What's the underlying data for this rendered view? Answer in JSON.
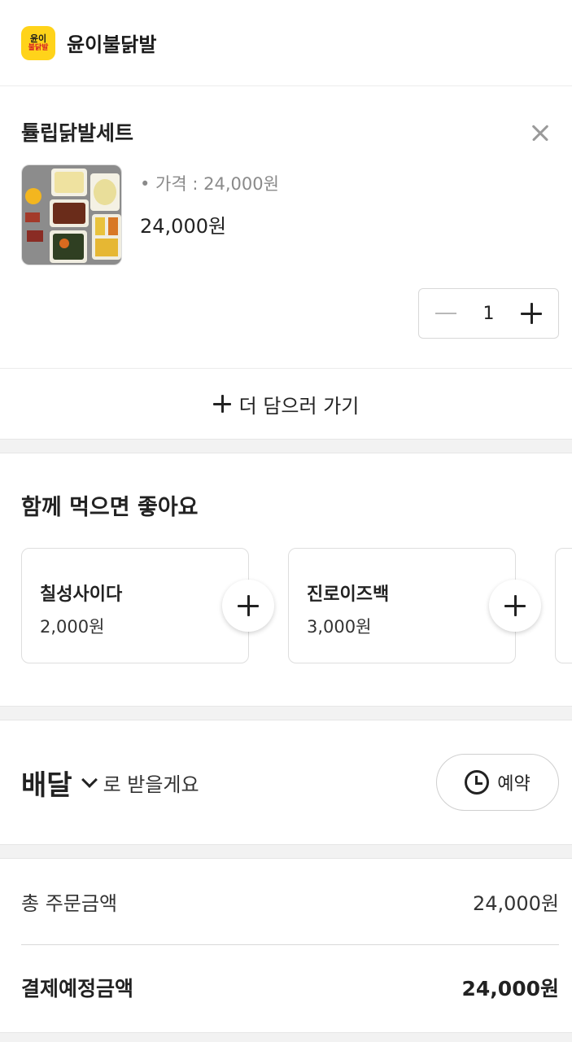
{
  "header": {
    "logo_line1": "윤이",
    "logo_line2": "불닭발",
    "store_name": "윤이불닭발"
  },
  "cart": {
    "item_name": "튤립닭발세트",
    "price_label": "• 가격 : 24,000원",
    "price": "24,000원",
    "quantity": "1"
  },
  "add_more": {
    "label": "더 담으러 가기"
  },
  "recommend": {
    "title": "함께 먹으면 좋아요",
    "items": [
      {
        "name": "칠성사이다",
        "price": "2,000원"
      },
      {
        "name": "진로이즈백",
        "price": "3,000원"
      }
    ]
  },
  "delivery": {
    "type": "배달",
    "suffix": "로 받을게요",
    "reserve_label": "예약"
  },
  "summary": {
    "total_label": "총 주문금액",
    "total_value": "24,000원",
    "pay_label": "결제예정금액",
    "pay_value": "24,000원"
  },
  "colors": {
    "brand_yellow": "#ffd31a",
    "brand_red": "#d61f26"
  },
  "icons": [
    "close-icon",
    "minus-icon",
    "plus-icon",
    "chevron-down-icon",
    "clock-icon"
  ]
}
